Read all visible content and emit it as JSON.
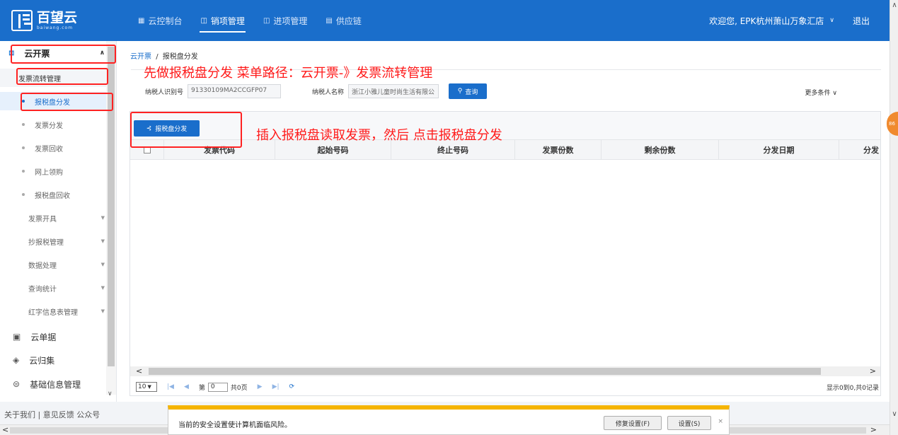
{
  "brand": {
    "name": "百望云",
    "sub": "baiwang.com"
  },
  "nav": [
    {
      "icon": "▦",
      "label": "云控制台"
    },
    {
      "icon": "◫",
      "label": "销项管理"
    },
    {
      "icon": "◫",
      "label": "进项管理"
    },
    {
      "icon": "▤",
      "label": "供应链"
    }
  ],
  "header": {
    "welcome": "欢迎您, EPK杭州萧山万象汇店",
    "dropdown": "∨",
    "logout": "退出"
  },
  "sidebar": {
    "top": "云开票",
    "section": "发票流转管理",
    "sub_items": [
      "报税盘分发",
      "发票分发",
      "发票回收",
      "网上领购",
      "报税盘回收"
    ],
    "groups": [
      "发票开具",
      "抄报税管理",
      "数据处理",
      "查询统计",
      "红字信息表管理"
    ],
    "bottom": [
      {
        "icon": "▣",
        "label": "云单据"
      },
      {
        "icon": "◈",
        "label": "云归集"
      },
      {
        "icon": "⊜",
        "label": "基础信息管理"
      }
    ]
  },
  "breadcrumb": {
    "home": "云开票",
    "sep": "/",
    "current": "报税盘分发"
  },
  "filter": {
    "taxpayer_id_label": "纳税人识别号",
    "taxpayer_id_value": "91330109MA2CCGFP07",
    "taxpayer_name_label": "纳税人名称",
    "taxpayer_name_value": "浙江小雅儿童时尚生活有限公",
    "query_icon": "⚲",
    "query_label": "查询",
    "more_label": "更多条件 ∨"
  },
  "toolbar": {
    "distribute_icon": "⊰",
    "distribute_label": "报税盘分发"
  },
  "table": {
    "columns": [
      "发票代码",
      "起始号码",
      "终止号码",
      "发票份数",
      "剩余份数",
      "分发日期",
      "分发"
    ]
  },
  "pager": {
    "page_size": "10",
    "page_prefix": "第",
    "page_value": "0",
    "page_total": "共0页",
    "info": "显示0到0,共0记录"
  },
  "annotations": {
    "top": "先做报税盘分发  菜单路径：云开票-》发票流转管理",
    "middle": "插入报税盘读取发票，然后 点击报税盘分发"
  },
  "footer": {
    "links": "关于我们  |  意见反馈    公众号"
  },
  "floating_ball": "86",
  "security_bar": {
    "message": "当前的安全设置使计算机面临风险。",
    "fix_label": "修复设置(F)",
    "settings_label": "设置(S)",
    "close": "×"
  },
  "colors": {
    "primary": "#1a6ecb",
    "annotation": "#ff1a1a",
    "warning": "#f5b400"
  }
}
